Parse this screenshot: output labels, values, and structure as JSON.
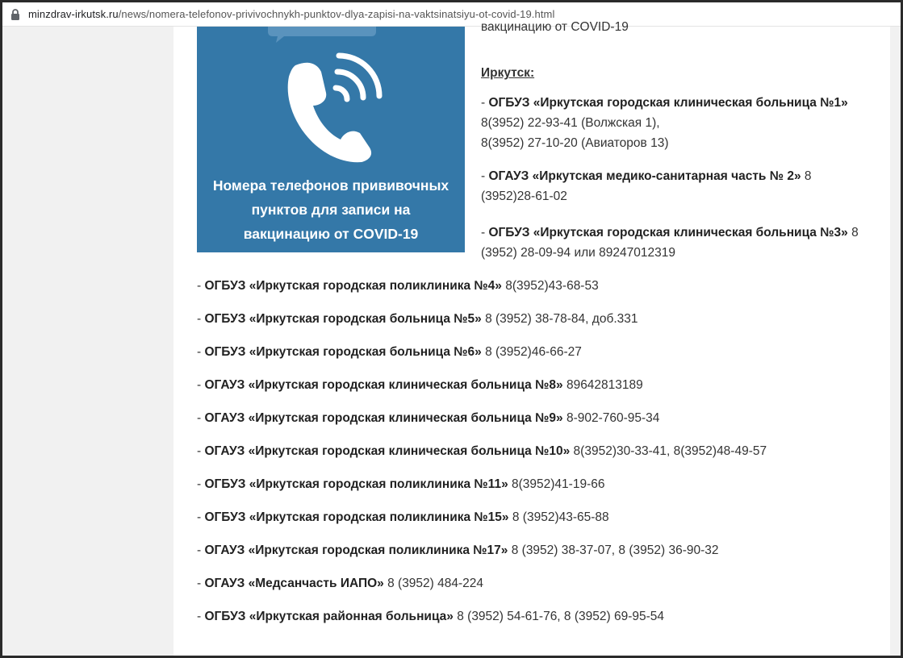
{
  "browser": {
    "url_domain": "minzdrav-irkutsk.ru",
    "url_path": "/news/nomera-telefonov-privivochnykh-punktov-dlya-zapisi-na-vaktsinatsiyu-ot-covid-19.html"
  },
  "poster": {
    "line1": "Номера телефонов прививочных",
    "line2": "пунктов для записи на",
    "line3": "вакцинацию от COVID-19"
  },
  "article": {
    "top_line": "вакцинацию от COVID-19",
    "city": "Иркутск:",
    "entries": [
      {
        "prefix": "- ",
        "name": "ОГБУЗ «Иркутская городская клиническая больница №1»",
        "phone": "",
        "phone2": "8(3952) 22-93-41 (Волжская 1),",
        "phone3": "8(3952) 27-10-20 (Авиаторов 13)"
      },
      {
        "prefix": "- ",
        "name": "ОГАУЗ «Иркутская медико-санитарная часть № 2»",
        "phone": " 8 (3952)28-61-02"
      },
      {
        "prefix": "- ",
        "name": "ОГБУЗ «Иркутская городская клиническая больница №3»",
        "phone": " 8 (3952) 28-09-94 или 89247012319"
      },
      {
        "prefix": "- ",
        "name": "ОГБУЗ «Иркутская городская поликлиника №4»",
        "phone": " 8(3952)43-68-53"
      },
      {
        "prefix": "- ",
        "name": "ОГБУЗ «Иркутская городская больница №5»",
        "phone": " 8 (3952) 38-78-84, доб.331"
      },
      {
        "prefix": "- ",
        "name": "ОГБУЗ «Иркутская городская больница №6»",
        "phone": " 8 (3952)46-66-27"
      },
      {
        "prefix": "- ",
        "name": "ОГАУЗ «Иркутская городская клиническая больница №8»",
        "phone": " 89642813189"
      },
      {
        "prefix": "- ",
        "name": "ОГАУЗ «Иркутская городская клиническая больница №9»",
        "phone": " 8-902-760-95-34"
      },
      {
        "prefix": "- ",
        "name": "ОГАУЗ «Иркутская городская клиническая больница №10»",
        "phone": " 8(3952)30-33-41, 8(3952)48-49-57"
      },
      {
        "prefix": "- ",
        "name": "ОГБУЗ «Иркутская городская поликлиника №11»",
        "phone": " 8(3952)41-19-66"
      },
      {
        "prefix": "- ",
        "name": "ОГБУЗ «Иркутская городская поликлиника №15»",
        "phone": " 8 (3952)43-65-88"
      },
      {
        "prefix": "- ",
        "name": "ОГАУЗ «Иркутская городская поликлиника №17»",
        "phone": " 8 (3952) 38-37-07, 8 (3952) 36-90-32"
      },
      {
        "prefix": "- ",
        "name": "ОГАУЗ «Медсанчасть ИАПО»",
        "phone": " 8 (3952) 484-224"
      },
      {
        "prefix": "- ",
        "name": "ОГБУЗ «Иркутская районная больница»",
        "phone": " 8 (3952) 54-61-76, 8 (3952) 69-95-54"
      }
    ]
  },
  "icons": {
    "lock": "lock-icon",
    "phone": "phone-icon"
  },
  "colors": {
    "poster_bg": "#3478a8",
    "text": "#333333",
    "page_bg": "#ffffff",
    "outer_bg": "#f1f1f1"
  }
}
